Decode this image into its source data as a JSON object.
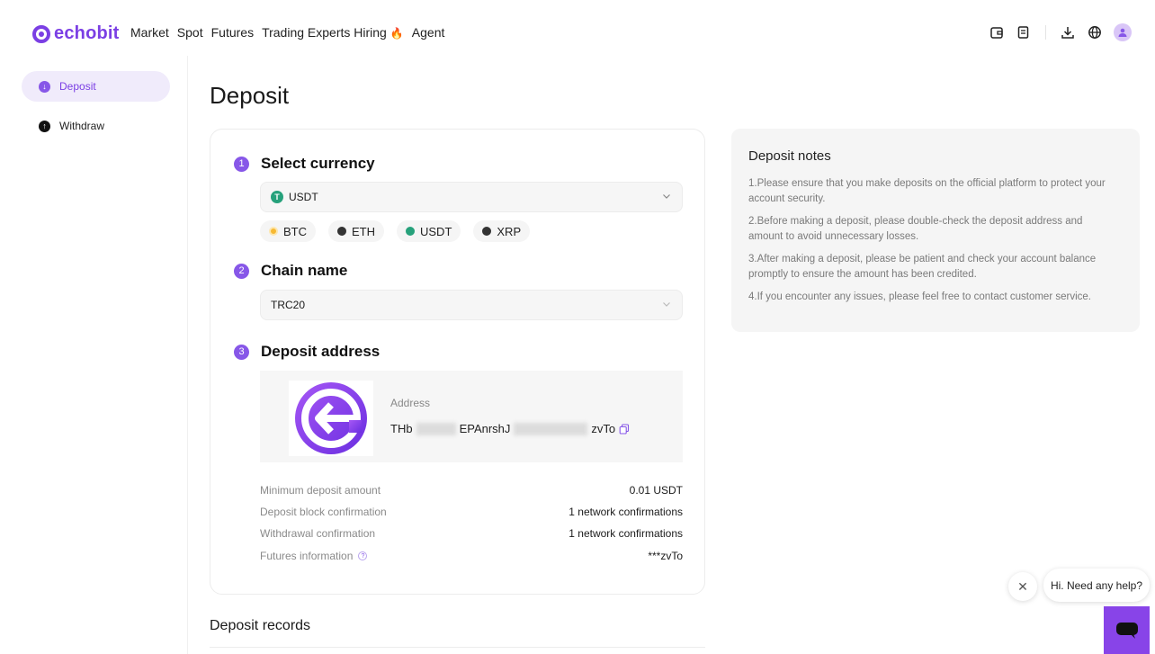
{
  "brand": {
    "name": "echobit",
    "accent": "#7b3fe4"
  },
  "nav": [
    {
      "label": "Market"
    },
    {
      "label": "Spot"
    },
    {
      "label": "Futures"
    },
    {
      "label": "Trading Experts Hiring"
    },
    {
      "label": "Agent"
    }
  ],
  "header_icons": [
    "wallet-icon",
    "orders-icon",
    "download-icon",
    "globe-icon",
    "user-avatar-icon"
  ],
  "sidebar": {
    "items": [
      {
        "label": "Deposit",
        "icon": "arrow-down-circle-icon",
        "active": true
      },
      {
        "label": "Withdraw",
        "icon": "arrow-up-circle-icon",
        "active": false
      }
    ]
  },
  "page": {
    "title": "Deposit"
  },
  "steps": {
    "currency": {
      "num": "1",
      "title": "Select currency",
      "selected": "USDT"
    },
    "chain": {
      "num": "2",
      "title": "Chain name",
      "selected": "TRC20"
    },
    "address": {
      "num": "3",
      "title": "Deposit address",
      "label": "Address",
      "value_start": "THb",
      "value_mid": "EPAnrshJ",
      "value_end": "zvTo"
    }
  },
  "currency_chips": [
    {
      "label": "BTC",
      "color": "#f7b933"
    },
    {
      "label": "ETH",
      "color": "#333333"
    },
    {
      "label": "USDT",
      "color": "#26a17b"
    },
    {
      "label": "XRP",
      "color": "#333333"
    }
  ],
  "info_rows": [
    {
      "key": "Minimum deposit amount",
      "value": "0.01 USDT"
    },
    {
      "key": "Deposit block confirmation",
      "value": "1 network confirmations"
    },
    {
      "key": "Withdrawal confirmation",
      "value": "1 network confirmations"
    },
    {
      "key": "Futures information",
      "value": "***zvTo"
    }
  ],
  "records": {
    "title": "Deposit records"
  },
  "notes": {
    "title": "Deposit notes",
    "items": [
      "1.Please ensure that you make deposits on the official platform to protect your account security.",
      "2.Before making a deposit, please double-check the deposit address and amount to avoid unnecessary losses.",
      "3.After making a deposit, please be patient and check your account balance promptly to ensure the amount has been credited.",
      "4.If you encounter any issues, please feel free to contact customer service."
    ]
  },
  "help": {
    "bubble": "Hi. Need any help?"
  }
}
